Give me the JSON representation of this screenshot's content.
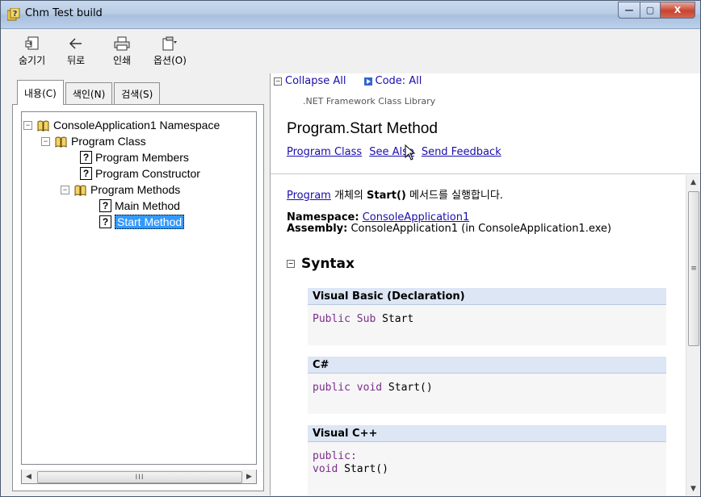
{
  "window": {
    "title": "Chm Test build",
    "buttons": {
      "minimize": "—",
      "maximize": "▢",
      "close": "X"
    }
  },
  "toolbar": {
    "hide": "숨기기",
    "back": "뒤로",
    "print": "인쇄",
    "options": "옵션(O)"
  },
  "tabs": [
    "내용(C)",
    "색인(N)",
    "검색(S)"
  ],
  "tree": {
    "namespace": "ConsoleApplication1 Namespace",
    "program_class": "Program Class",
    "program_members": "Program Members",
    "program_constructor": "Program Constructor",
    "program_methods": "Program Methods",
    "main_method": "Main Method",
    "start_method": "Start Method",
    "scroll_grip": "III"
  },
  "content": {
    "collapse_all": "Collapse All",
    "code_all": "Code: All",
    "library": ".NET Framework Class Library",
    "title": "Program.Start Method",
    "links": [
      "Program Class",
      "See Also",
      "Send Feedback"
    ],
    "desc_link": "Program",
    "desc_text1": " 개체의 ",
    "desc_bold": "Start()",
    "desc_text2": " 메서드를 실행합니다.",
    "namespace_label": "Namespace:",
    "namespace_value": "ConsoleApplication1",
    "assembly_label": "Assembly:",
    "assembly_value": "ConsoleApplication1 (in ConsoleApplication1.exe)",
    "syntax_heading": "Syntax",
    "vs_grip": "≡",
    "code_blocks": [
      {
        "lang": "Visual Basic (Declaration)",
        "kw": "Public Sub",
        "rest": " Start"
      },
      {
        "lang": "C#",
        "kw": "public void",
        "rest": " Start()"
      },
      {
        "lang": "Visual C++",
        "kw": "public:",
        "line2_kw": "void",
        "line2_rest": " Start()"
      }
    ]
  },
  "colors": {
    "link": "#1a0dab",
    "selection": "#3399ff",
    "keyword": "#7a2d8c",
    "code_header": "#dce6f4"
  },
  "icons": [
    "help-icon",
    "hide-icon",
    "back-icon",
    "print-icon",
    "options-icon",
    "book-icon",
    "question-page-icon",
    "mouse-cursor-icon"
  ]
}
